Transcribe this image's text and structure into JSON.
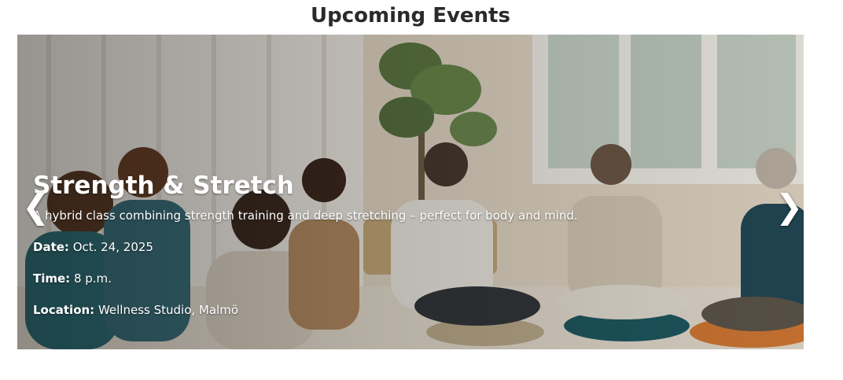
{
  "page": {
    "title": "Upcoming Events"
  },
  "carousel": {
    "prev_glyph": "❮",
    "next_glyph": "❯",
    "slide": {
      "title": "Strength & Stretch",
      "description": "A hybrid class combining strength training and deep stretching – perfect for body and mind.",
      "date_label": "Date:",
      "date_value": " Oct. 24, 2025",
      "time_label": "Time:",
      "time_value": " 8 p.m.",
      "location_label": "Location:",
      "location_value": " Wellness Studio, Malmö"
    }
  },
  "icons": {
    "prev": "chevron-left-icon",
    "next": "chevron-right-icon"
  },
  "colors": {
    "title_text": "#2a2a2a",
    "caption_text": "#ffffff",
    "room_wall": "#e8dccb"
  }
}
